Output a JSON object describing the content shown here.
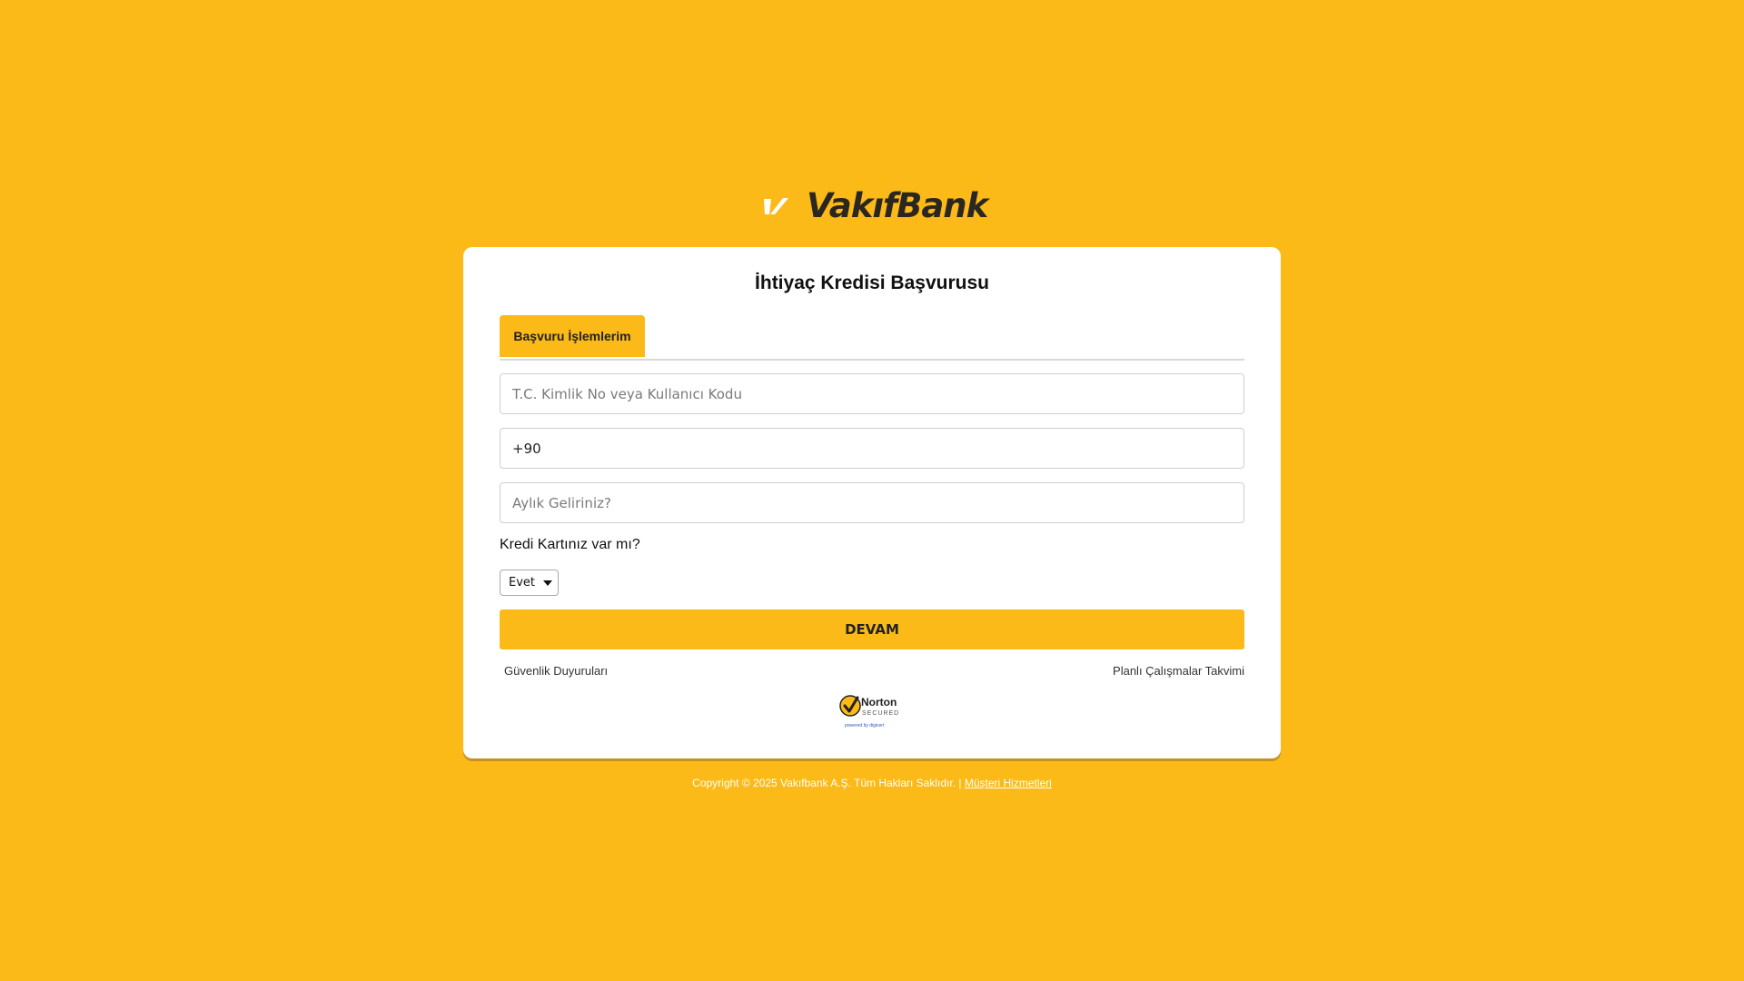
{
  "brand": {
    "name": "VakıfBank",
    "logo_icon": "vakifbank-logo-mark-icon",
    "accent_color": "#fbba17",
    "text_color": "#2b2620"
  },
  "card": {
    "title": "İhtiyaç Kredisi Başvurusu",
    "tabs": [
      {
        "label": "Başvuru İşlemlerim",
        "active": true
      }
    ]
  },
  "form": {
    "tc_placeholder": "T.C. Kimlik No veya Kullanıcı Kodu",
    "tc_value": "",
    "phone_value": "+90",
    "phone_placeholder": "",
    "income_placeholder": "Aylık Geliriniz?",
    "income_value": "",
    "credit_card_question": "Kredi Kartınız var mı?",
    "credit_card_selected": "Evet",
    "submit_label": "DEVAM"
  },
  "links": {
    "security": "Güvenlik Duyuruları",
    "maintenance": "Planlı Çalışmalar Takvimi"
  },
  "badge": {
    "name": "Norton",
    "secured": "SECURED",
    "powered": "powered by digicert",
    "icon": "norton-secured-badge-icon"
  },
  "footer": {
    "copyright": "Copyright © 2025 Vakıfbank A.Ş. Tüm Hakları Saklıdır. |",
    "link": "Müşteri Hizmetleri"
  }
}
